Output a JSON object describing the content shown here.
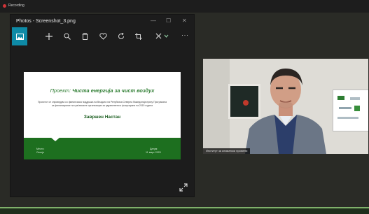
{
  "app": {
    "rec_label": "Recording"
  },
  "photos": {
    "title": "Photos - Screenshot_3.png",
    "window_controls": [
      "—",
      "☐",
      "✕"
    ],
    "toolbar": [
      "image-icon",
      "add-icon",
      "zoom-icon",
      "delete-icon",
      "favorite-icon",
      "rotate-icon",
      "crop-icon",
      "edit-icon",
      "more-icon"
    ],
    "more_label": "···",
    "accent_color": "#0e8aa6"
  },
  "slide": {
    "title_prefix": "Проект:",
    "title_main": "Чиста енергија за чист воздух",
    "note": "Проектот се спроведува со финансиска поддршка на Владата на Република Северна Македонија преку Програмата за финансирање на граѓанските организации за здравствени и фокусирани на 2019 година",
    "event": "Завршен Настан",
    "place_label": "Место:",
    "place_value": "Скопје",
    "date_label": "Датум:",
    "date_value": "11 март 2020",
    "brand_color": "#1d6f1f"
  },
  "video": {
    "participant_name": "Институт за климатски промени"
  }
}
